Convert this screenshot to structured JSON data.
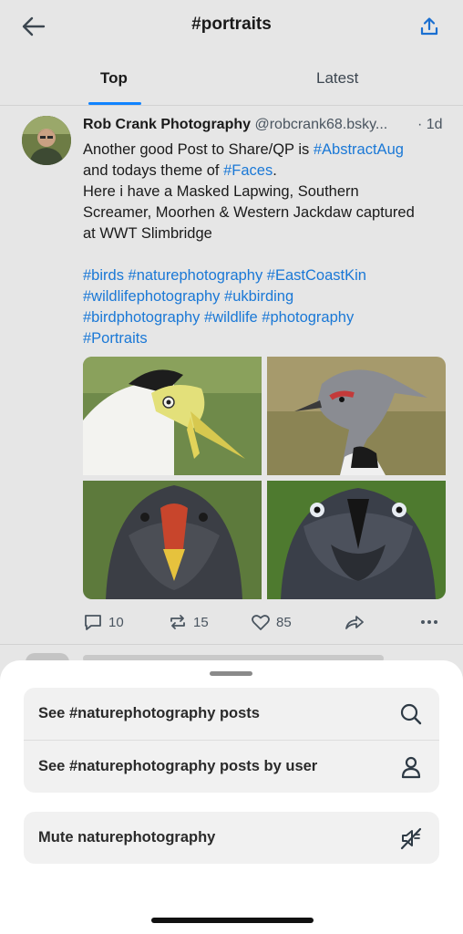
{
  "header": {
    "title": "#portraits",
    "back_icon": "arrow-left-icon",
    "share_icon": "share-upload-icon"
  },
  "tabs": [
    {
      "label": "Top",
      "active": true
    },
    {
      "label": "Latest",
      "active": false
    }
  ],
  "post": {
    "author": "Rob Crank Photography",
    "handle": "@robcrank68.bsky...",
    "time": "· 1d",
    "text": {
      "line1_prefix": "Another good Post to Share/QP is ",
      "line1_tag": "#AbstractAug",
      "line2_prefix": "and todays theme of  ",
      "line2_tag": "#Faces",
      "line2_suffix": ".",
      "line3": "Here i have a Masked Lapwing, Southern",
      "line4": "Screamer, Moorhen & Western Jackdaw captured",
      "line5": "at WWT Slimbridge",
      "tags_line1": "#birds #naturephotography #EastCoastKin",
      "tags_line2": "#wildlifephotography #ukbirding",
      "tags_line3": "#birdphotography #wildlife #photography",
      "tags_line4": "#Portraits"
    },
    "images": [
      "masked-lapwing-photo",
      "southern-screamer-photo",
      "moorhen-photo",
      "western-jackdaw-photo"
    ],
    "actions": {
      "replies": "10",
      "reposts": "15",
      "likes": "85"
    }
  },
  "sheet": {
    "items": [
      {
        "label": "See #naturephotography posts",
        "icon": "search-icon"
      },
      {
        "label": "See #naturephotography posts by user",
        "icon": "user-icon"
      }
    ],
    "mute": {
      "label": "Mute naturephotography",
      "icon": "mute-icon"
    }
  },
  "colors": {
    "accent": "#1083fe",
    "link": "#1a78d6",
    "sheet_bg": "#ffffff",
    "dim_bg": "#e6e6e6"
  }
}
